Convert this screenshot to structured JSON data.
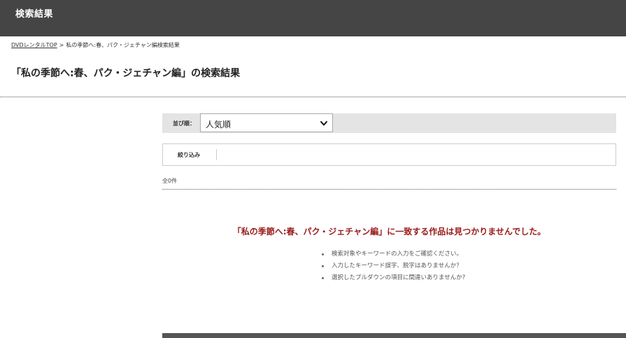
{
  "header": {
    "title": "検索結果"
  },
  "breadcrumb": {
    "home_link": "DVDレンタルTOP",
    "separator": ">",
    "current": "私の季節へ:春、パク・ジェチャン編検索結果"
  },
  "page_title": "「私の季節へ:春、パク・ジェチャン編」の検索結果",
  "sort": {
    "label": "並び順：",
    "selected": "人気順",
    "icon": "chevron-down-icon"
  },
  "filter": {
    "label": "絞り込み"
  },
  "results": {
    "count_text": "全0件",
    "not_found_message": "「私の季節へ:春、パク・ジェチャン編」に一致する作品は見つかりませんでした。",
    "hints": [
      "検索対象やキーワードの入力をご確認ください。",
      "入力したキーワード誤字、脱字はありませんか？",
      "選択したプルダウンの項目に間違いありませんか?"
    ]
  },
  "colors": {
    "header_bg": "#454545",
    "sort_bar_bg": "#e4e4e4",
    "error_text": "#9a1b1b"
  }
}
